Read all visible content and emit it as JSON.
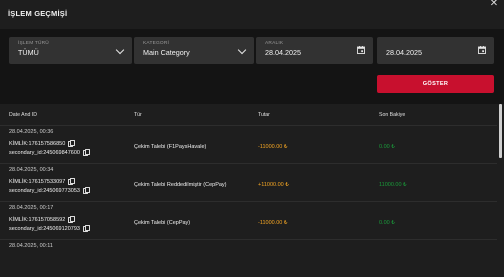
{
  "header": {
    "title": "İŞLEM GEÇMİŞİ",
    "close_icon": "close-icon"
  },
  "filters": {
    "type": {
      "label": "İŞLEM TÜRÜ",
      "value": "TÜMÜ"
    },
    "category": {
      "label": "KATEGORİ",
      "value": "Main Category"
    },
    "range_start": {
      "label": "ARALIK",
      "value": "28.04.2025"
    },
    "range_end": {
      "label": "",
      "value": "28.04.2025"
    },
    "show_button": "GÖSTER"
  },
  "table": {
    "columns": [
      "Date And ID",
      "Tür",
      "Tutar",
      "Son Bakiye"
    ],
    "rows": [
      {
        "date": "28.04.2025, 00:36",
        "kimlik": "KİMLİK:176157586850",
        "secondary": "secondary_id:245069847600",
        "type": "Çekim Talebi (F1PaysHavale)",
        "amount": "-11000.00 ₺",
        "balance": "0.00 ₺"
      },
      {
        "date": "28.04.2025, 00:34",
        "kimlik": "KİMLİK:176157533097",
        "secondary": "secondary_id:245069773053",
        "type": "Çekim Talebi Reddedilmiştir (CepPay)",
        "amount": "+11000.00 ₺",
        "balance": "11000.00 ₺"
      },
      {
        "date": "28.04.2025, 00:17",
        "kimlik": "KİMLİK:176157058592",
        "secondary": "secondary_id:245069120793",
        "type": "Çekim Talebi (CepPay)",
        "amount": "-11000.00 ₺",
        "balance": "0.00 ₺"
      },
      {
        "date": "28.04.2025, 00:11"
      }
    ]
  },
  "colors": {
    "accent": "#c8102e",
    "amount": "#f5a623",
    "balance": "#1a9b3a",
    "background": "#1e1e1e",
    "panel": "#141414"
  }
}
